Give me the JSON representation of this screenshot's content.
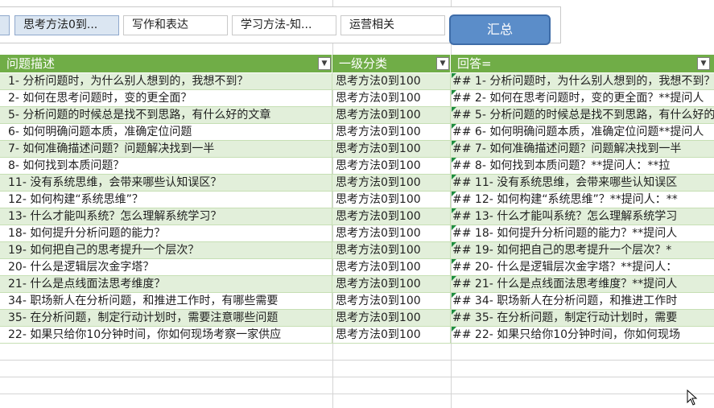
{
  "slicer": {
    "buttons": [
      {
        "label": "",
        "selected": true
      },
      {
        "label": "思考方法0到...",
        "selected": true
      },
      {
        "label": "写作和表达",
        "selected": false
      },
      {
        "label": "学习方法-知...",
        "selected": false
      },
      {
        "label": "运营相关",
        "selected": false
      }
    ],
    "sum_button": "汇总"
  },
  "header": {
    "col1": "问题描述",
    "col2": "一级分类",
    "col3": "回答="
  },
  "rows": [
    {
      "q": "1- 分析问题时，为什么别人想到的，我想不到？",
      "cat": "思考方法0到100",
      "ans": "## 1- 分析问题时，为什么别人想到的，我想不到？"
    },
    {
      "q": "2- 如何在思考问题时，变的更全面？",
      "cat": "思考方法0到100",
      "ans": "## 2- 如何在思考问题时，变的更全面？**提问人"
    },
    {
      "q": "5- 分析问题的时候总是找不到思路，有什么好的文章",
      "cat": "思考方法0到100",
      "ans": "## 5- 分析问题的时候总是找不到思路，有什么好的"
    },
    {
      "q": "6- 如何明确问题本质，准确定位问题",
      "cat": "思考方法0到100",
      "ans": "## 6- 如何明确问题本质，准确定位问题**提问人"
    },
    {
      "q": "7- 如何准确描述问题？问题解决找到一半",
      "cat": "思考方法0到100",
      "ans": "## 7- 如何准确描述问题？问题解决找到一半"
    },
    {
      "q": "8- 如何找到本质问题？",
      "cat": "思考方法0到100",
      "ans": "## 8- 如何找到本质问题？**提问人：**拉"
    },
    {
      "q": "11- 没有系统思维，会带来哪些认知误区？",
      "cat": "思考方法0到100",
      "ans": "## 11- 没有系统思维，会带来哪些认知误区"
    },
    {
      "q": "12- 如何构建“系统思维”？",
      "cat": "思考方法0到100",
      "ans": "## 12- 如何构建“系统思维”？**提问人：**"
    },
    {
      "q": "13- 什么才能叫系统？怎么理解系统学习？",
      "cat": "思考方法0到100",
      "ans": "## 13- 什么才能叫系统？怎么理解系统学习"
    },
    {
      "q": "18- 如何提升分析问题的能力？",
      "cat": "思考方法0到100",
      "ans": "## 18- 如何提升分析问题的能力？**提问人"
    },
    {
      "q": "19- 如何把自己的思考提升一个层次？",
      "cat": "思考方法0到100",
      "ans": "## 19- 如何把自己的思考提升一个层次？*"
    },
    {
      "q": "20- 什么是逻辑层次金字塔？",
      "cat": "思考方法0到100",
      "ans": "## 20- 什么是逻辑层次金字塔？**提问人："
    },
    {
      "q": "21- 什么是点线面法思考维度？",
      "cat": "思考方法0到100",
      "ans": "## 21- 什么是点线面法思考维度？**提问人"
    },
    {
      "q": "34- 职场新人在分析问题，和推进工作时，有哪些需要",
      "cat": "思考方法0到100",
      "ans": "## 34- 职场新人在分析问题，和推进工作时"
    },
    {
      "q": "35- 在分析问题，制定行动计划时，需要注意哪些问题",
      "cat": "思考方法0到100",
      "ans": "## 35- 在分析问题，制定行动计划时，需要"
    },
    {
      "q": "22- 如果只给你10分钟时间，你如何现场考察一家供应",
      "cat": "思考方法0到100",
      "ans": "## 22- 如果只给你10分钟时间，你如何现场"
    }
  ]
}
